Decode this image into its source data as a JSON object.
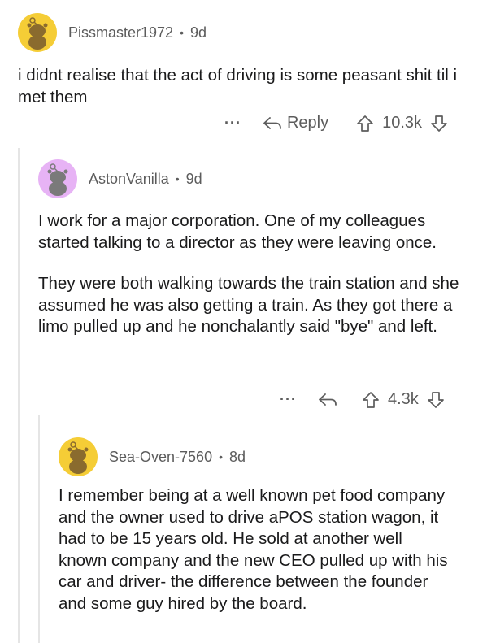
{
  "comments": [
    {
      "username": "Pissmaster1972",
      "age": "9d",
      "avatar_bg": "#f5cd36",
      "paragraphs": [
        "i didnt realise that the act of driving is some peasant shit til i met them"
      ],
      "reply_label": "Reply",
      "votes": "10.3k"
    },
    {
      "username": "AstonVanilla",
      "age": "9d",
      "avatar_bg": "#e7b3f5",
      "paragraphs": [
        "I work for a major corporation. One of my colleagues started talking to a director as they were leaving once.",
        "They were both walking towards the train station and she assumed he was also getting a train. As they got there a limo pulled up and he nonchalantly said \"bye\" and left."
      ],
      "votes": "4.3k"
    },
    {
      "username": "Sea-Oven-7560",
      "age": "8d",
      "avatar_bg": "#f5cd36",
      "paragraphs": [
        "I remember being at a well known pet food company and the owner used to drive aPOS station wagon, it had to be 15 years old.  He sold at another well known company and the new CEO pulled up with his car and driver- the difference between the founder and some guy hired by the board."
      ]
    }
  ],
  "more_label": "···",
  "icons": {
    "more": "ellipsis-icon",
    "reply": "reply-arrow-icon",
    "upvote": "upvote-arrow-icon",
    "downvote": "downvote-arrow-icon",
    "avatar": "snoo-avatar-icon"
  }
}
